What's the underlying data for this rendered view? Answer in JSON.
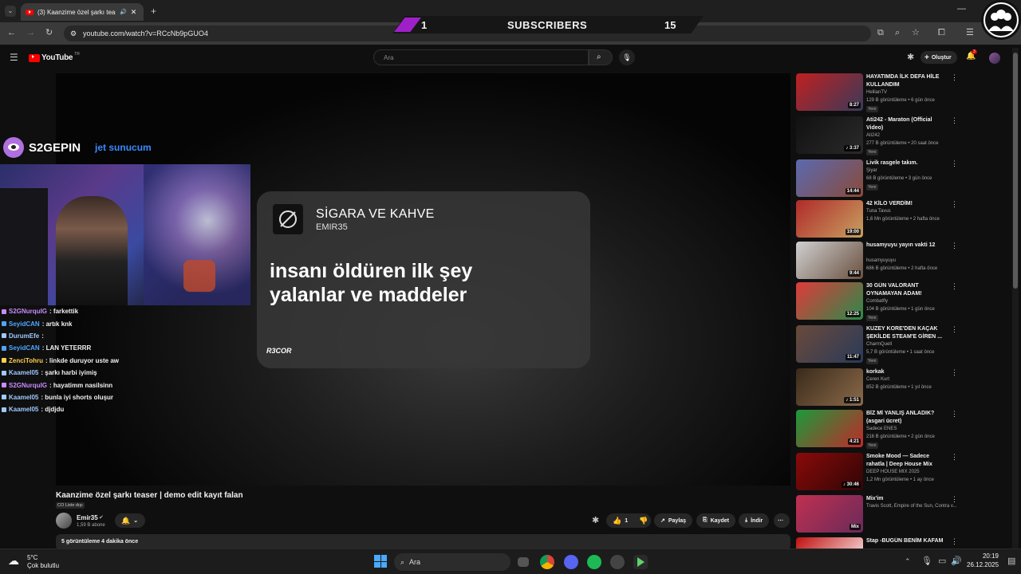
{
  "browser": {
    "tab_title": "(3) Kaanzime özel şarkı teas",
    "url": "youtube.com/watch?v=RCcNb9pGUO4",
    "new_tab_symbol": "+"
  },
  "sub_overlay": {
    "left": "1",
    "label": "SUBSCRIBERS",
    "right": "15"
  },
  "youtube": {
    "logo": "YouTube",
    "region": "TR",
    "search_placeholder": "Ara",
    "create_label": "Oluştur",
    "notif_count": "3"
  },
  "stream": {
    "brand_left": "S2GEPIN",
    "brand_right": "jet sunucum",
    "chat": [
      {
        "user": "S2GNurquIG",
        "msg": ": farkettik",
        "color": "#c88cff"
      },
      {
        "user": "SeyidCAN",
        "msg": ": artık knk",
        "color": "#4da6ff"
      },
      {
        "user": "DurumEfe",
        "msg": ": ",
        "color": "#9ec9ff"
      },
      {
        "user": "SeyidCAN",
        "msg": ": LAN YETERRR",
        "color": "#4da6ff"
      },
      {
        "user": "ZenciTohru",
        "msg": ": linkde duruyor uste aw",
        "color": "#ffd24d"
      },
      {
        "user": "Kaamel05",
        "msg": ": şarkı harbi iyimiş",
        "color": "#9ec9ff"
      },
      {
        "user": "S2GNurquIG",
        "msg": ": hayatimm nasilsinn",
        "color": "#c88cff"
      },
      {
        "user": "Kaamel05",
        "msg": ": bunla iyi shorts oluşur",
        "color": "#9ec9ff"
      },
      {
        "user": "Kaamel05",
        "msg": ": djdjdu",
        "color": "#9ec9ff"
      }
    ]
  },
  "card": {
    "song": "SİGARA VE KAHVE",
    "artist": "EMIR35",
    "lyric1": "insanı öldüren ilk şey",
    "lyric2": "yalanlar ve maddeler",
    "watermark": "R3COR"
  },
  "video": {
    "title": "Kaanzime özel şarkı teaser | demo edit kayıt falan",
    "cc_tag": "CO Liste dışı",
    "channel": "Emir35",
    "subs": "1,59 B abone",
    "likes": "1",
    "share": "Paylaş",
    "save": "Kaydet",
    "download": "İndir",
    "desc_stats": "5 görüntüleme  4 dakika önce"
  },
  "sidebar": [
    {
      "title": "HAYATIMDA İLK DEFA HİLE KULLANDIM",
      "channel": "HellianTV",
      "verified": true,
      "meta": "129 B görüntüleme • 6 gün önce",
      "new": "Yeni",
      "dur": "8:27",
      "c1": "#c02020",
      "c2": "#3a3a5a"
    },
    {
      "title": "Ati242 - Maraton (Official Video)",
      "channel": "Ati242",
      "verified": true,
      "meta": "277 B görüntüleme • 20 saat önce",
      "new": "Yeni",
      "dur": "♪ 3:37",
      "c1": "#111",
      "c2": "#2a2a2a"
    },
    {
      "title": "Livik rasgele takım.",
      "channel": "Şiyar",
      "verified": false,
      "meta": "68 B görüntüleme • 3 gün önce",
      "new": "Yeni",
      "dur": "14:44",
      "c1": "#5a6ab0",
      "c2": "#8a4a3a"
    },
    {
      "title": "42 KİLO VERDİM!",
      "channel": "Tuna Tavus",
      "verified": true,
      "meta": "1,6 Mn görüntüleme • 2 hafta önce",
      "new": "",
      "dur": "19:00",
      "c1": "#b02a2a",
      "c2": "#c8a060"
    },
    {
      "title": "husamyuyu yayın vakti 12",
      "channel": "husamyuyuyu",
      "verified": false,
      "meta": "686 B görüntüleme • 2 hafta önce",
      "new": "",
      "dur": "9:44",
      "c1": "#d0d0d0",
      "c2": "#6a5040"
    },
    {
      "title": "30 GÜN VALORANT OYNAMAYAN ADAM!",
      "channel": "Combatfly",
      "verified": true,
      "meta": "104 B görüntüleme • 1 gün önce",
      "new": "Yeni",
      "dur": "12:25",
      "c1": "#e03a3a",
      "c2": "#2a8a4a"
    },
    {
      "title": "KUZEY KORE'DEN KAÇAK ŞEKİLDE STEAM'E GİREN ...",
      "channel": "CharmQuell",
      "verified": true,
      "meta": "5,7 B görüntüleme • 1 saat önce",
      "new": "Yeni",
      "dur": "11:47",
      "c1": "#6a4a3a",
      "c2": "#2a3a5a"
    },
    {
      "title": "korkak",
      "channel": "Ceren Kurt",
      "verified": false,
      "meta": "852 B görüntüleme • 1 yıl önce",
      "new": "",
      "dur": "♪ 1:51",
      "c1": "#3a2a1a",
      "c2": "#8a6a4a"
    },
    {
      "title": "BİZ Mİ YANLIŞ ANLADIK? (asgari ücret)",
      "channel": "Sadece ENES",
      "verified": true,
      "meta": "216 B görüntüleme • 2 gün önce",
      "new": "Yeni",
      "dur": "4:21",
      "c1": "#1a9a3a",
      "c2": "#c02a2a"
    },
    {
      "title": "Smoke Mood — Sadece rahatla | Deep House Mix 2025 • Chill / ...",
      "channel": "DEEP HOUSE MIX 2025",
      "verified": false,
      "meta": "1,2 Mn görüntüleme • 1 ay önce",
      "new": "",
      "dur": "♪ 30:46",
      "c1": "#8a0a0a",
      "c2": "#300505"
    },
    {
      "title": "Mix'im",
      "channel": "Travis Scott, Empire of the Sun, Contra v...",
      "verified": false,
      "meta": "",
      "new": "",
      "dur": "Mix",
      "c1": "#c03050",
      "c2": "#6a2a5a"
    },
    {
      "title": "Stap -BUGÜN BENİM KAFAM",
      "channel": "",
      "verified": false,
      "meta": "",
      "new": "",
      "dur": "",
      "c1": "#c01010",
      "c2": "#ffffff"
    }
  ],
  "taskbar": {
    "temp": "5°C",
    "weather": "Çok bulutlu",
    "search": "Ara",
    "time": "20:19",
    "date": "26.12.2025"
  }
}
